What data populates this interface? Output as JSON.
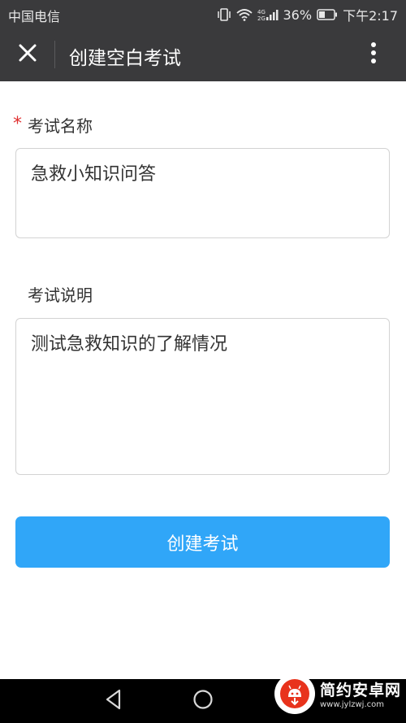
{
  "status_bar": {
    "carrier": "中国电信",
    "battery": "36%",
    "time": "下午2:17",
    "network": "4G"
  },
  "header": {
    "title": "创建空白考试",
    "close_icon": "close-icon",
    "more_icon": "more-vertical-icon"
  },
  "form": {
    "exam_name": {
      "label": "考试名称",
      "required_mark": "*",
      "value": "急救小知识问答"
    },
    "exam_description": {
      "label": "考试说明",
      "value": "测试急救知识的了解情况"
    },
    "submit_label": "创建考试"
  },
  "nav_bar": {
    "back_icon": "back-triangle-icon",
    "home_icon": "home-circle-icon",
    "recents_icon": "recents-square-icon"
  },
  "watermark": {
    "brand": "简约安卓网",
    "url": "www.jylzwj.com"
  },
  "colors": {
    "bar_bg": "#3a3a3c",
    "primary": "#30a6f8",
    "required": "#e03131",
    "border": "#d3d3d3"
  }
}
